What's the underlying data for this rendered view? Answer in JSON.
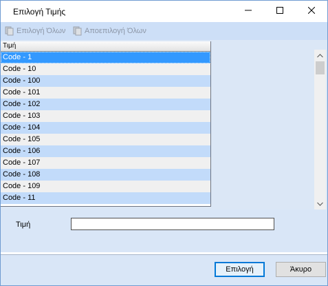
{
  "window": {
    "title": "Επιλογή Τιμής"
  },
  "toolbar": {
    "select_all_label": "Επιλογή Όλων",
    "deselect_all_label": "Αποεπιλογή Όλων"
  },
  "grid": {
    "column_header": "Τιμή",
    "rows": [
      "Code - 1",
      "Code - 10",
      "Code - 100",
      "Code - 101",
      "Code - 102",
      "Code - 103",
      "Code - 104",
      "Code - 105",
      "Code - 106",
      "Code - 107",
      "Code - 108",
      "Code - 109",
      "Code - 11"
    ],
    "selected_index": 0
  },
  "form": {
    "value_label": "Τιμή",
    "value_input": ""
  },
  "buttons": {
    "ok_label": "Επιλογή",
    "cancel_label": "Άκυρο"
  },
  "colors": {
    "selection": "#3399ff",
    "row_alt": "#c2dbfa",
    "panel": "#d9e6f7"
  }
}
